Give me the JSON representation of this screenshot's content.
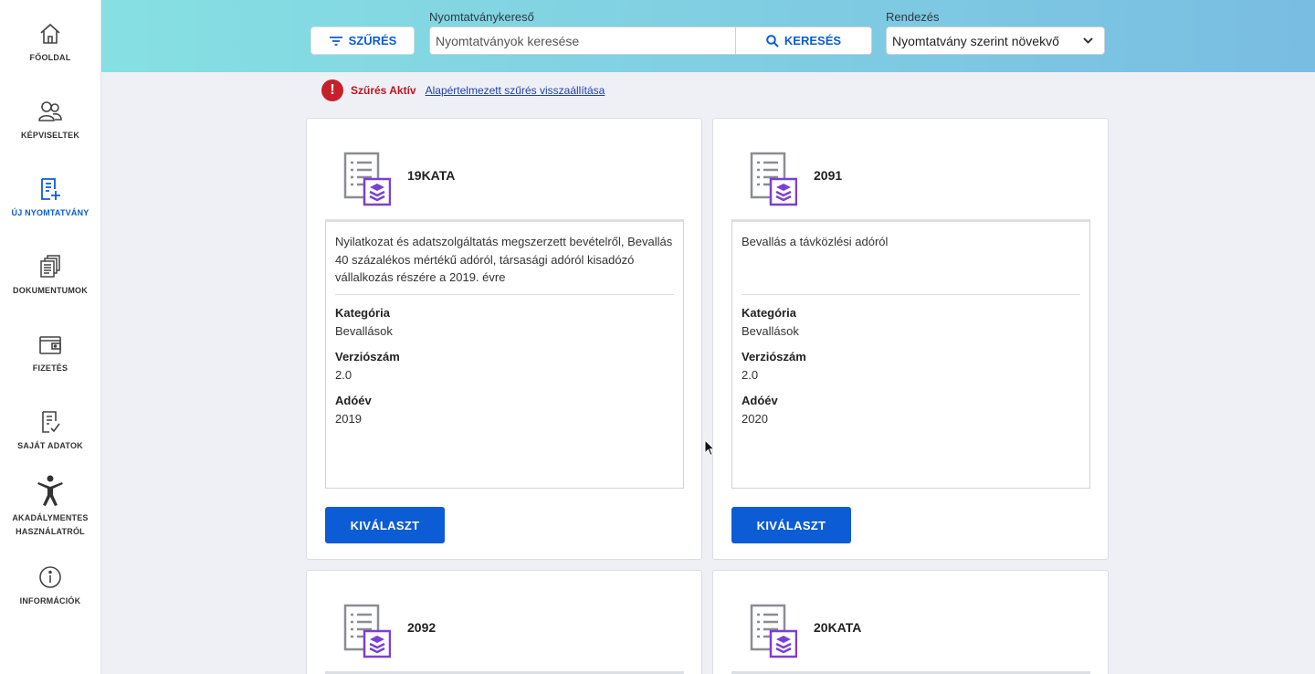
{
  "sidebar": {
    "items": [
      {
        "label": "FŐOLDAL",
        "icon": "home-icon"
      },
      {
        "label": "KÉPVISELTEK",
        "icon": "users-icon"
      },
      {
        "label": "ÚJ NYOMTATVÁNY",
        "icon": "new-form-icon",
        "active": true
      },
      {
        "label": "DOKUMENTUMOK",
        "icon": "documents-icon"
      },
      {
        "label": "FIZETÉS",
        "icon": "wallet-icon"
      },
      {
        "label": "SAJÁT ADATOK",
        "icon": "profile-data-icon"
      },
      {
        "label": "AKADÁLYMENTES HASZNÁLATRÓL",
        "icon": "accessibility-icon"
      },
      {
        "label": "INFORMÁCIÓK",
        "icon": "info-icon"
      }
    ]
  },
  "header": {
    "filter_button": "SZŰRÉS",
    "search_label": "Nyomtatványkereső",
    "search_placeholder": "Nyomtatványok keresése",
    "search_button": "KERESÉS",
    "sort_label": "Rendezés",
    "sort_value": "Nyomtatvány szerint növekvő"
  },
  "filter_status": {
    "active_text": "Szűrés Aktív",
    "reset_link": "Alapértelmezett szűrés visszaállítása"
  },
  "labels": {
    "category": "Kategória",
    "version": "Verziószám",
    "tax_year": "Adóév",
    "select_button": "KIVÁLASZT"
  },
  "cards": [
    {
      "title": "19KATA",
      "description": "Nyilatkozat és adatszolgáltatás megszerzett bevételről, Bevallás 40 százalékos mértékű adóról, társasági adóról kisadózó vállalkozás részére a 2019. évre",
      "category": "Bevallások",
      "version": "2.0",
      "tax_year": "2019"
    },
    {
      "title": "2091",
      "description": "Bevallás a távközlési adóról",
      "category": "Bevallások",
      "version": "2.0",
      "tax_year": "2020"
    },
    {
      "title": "2092"
    },
    {
      "title": "20KATA"
    }
  ],
  "colors": {
    "primary": "#0b5cd5",
    "header_gradient_start": "#86e0e2",
    "header_gradient_end": "#79bde2",
    "alert": "#c8202b",
    "form_icon_accent": "#7b3fd6"
  }
}
